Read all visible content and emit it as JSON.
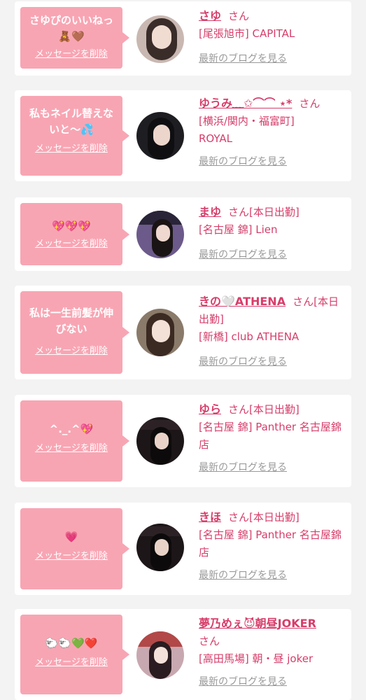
{
  "delete_label": "メッセージを削除",
  "blog_label": "最新のブログを見る",
  "items": [
    {
      "message": "さゆぴのいいねっ🧸🤎",
      "name": "さゆ",
      "honorific": "さん",
      "status": "",
      "shop": "[尾張旭市] CAPITAL"
    },
    {
      "message": "私もネイル替えないと〜💦",
      "name": "ゆうみ﹏✩⌒⌒ ⋆*",
      "honorific": "さん",
      "status": "",
      "shop": "[横浜/関内・福富町] ROYAL"
    },
    {
      "message": "💖💖💖",
      "name": "まゆ",
      "honorific": "さん",
      "status": "[本日出勤]",
      "shop": "[名古屋 錦] Lien"
    },
    {
      "message": "私は一生前髪が伸びない",
      "name": "きの🤍ATHENA",
      "honorific": "さん",
      "status": "[本日出勤]",
      "shop": "[新橋] club ATHENA"
    },
    {
      "message": "^._.^💖",
      "name": "ゆら",
      "honorific": "さん",
      "status": "[本日出勤]",
      "shop": "[名古屋 錦] Panther 名古屋錦店"
    },
    {
      "message": "💗",
      "name": "きほ",
      "honorific": "さん",
      "status": "[本日出勤]",
      "shop": "[名古屋 錦] Panther 名古屋錦店"
    },
    {
      "message": "🐑🐑💚❤️",
      "name": "夢乃めぇ😈朝昼JOKER",
      "honorific": "さん",
      "status": "",
      "shop": "[高田馬場] 朝・昼 joker"
    }
  ],
  "colors": {
    "accent": "#d63d6a",
    "bubble": "#f8a5b3",
    "card": "#ffffff",
    "background": "#f3f3f3",
    "muted": "#9a9a9a"
  }
}
